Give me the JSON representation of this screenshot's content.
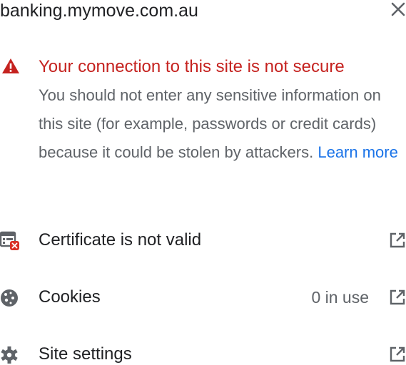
{
  "header": {
    "domain": "banking.mymove.com.au",
    "close_icon": "close-icon"
  },
  "warning": {
    "icon": "warning-triangle-icon",
    "title": "Your connection to this site is not secure",
    "body": "You should not enter any sensitive information on this site (for example, passwords or credit cards) because it could be stolen by attackers. ",
    "learn_more": "Learn more",
    "title_color": "#c5221f",
    "link_color": "#1a73e8"
  },
  "rows": [
    {
      "label": "Certificate is not valid",
      "value": "",
      "icon": "certificate-error-icon",
      "action_icon": "open-external-icon"
    },
    {
      "label": "Cookies",
      "value": "0 in use",
      "icon": "cookie-icon",
      "action_icon": "open-external-icon"
    },
    {
      "label": "Site settings",
      "value": "",
      "icon": "gear-icon",
      "action_icon": "open-external-icon"
    }
  ]
}
